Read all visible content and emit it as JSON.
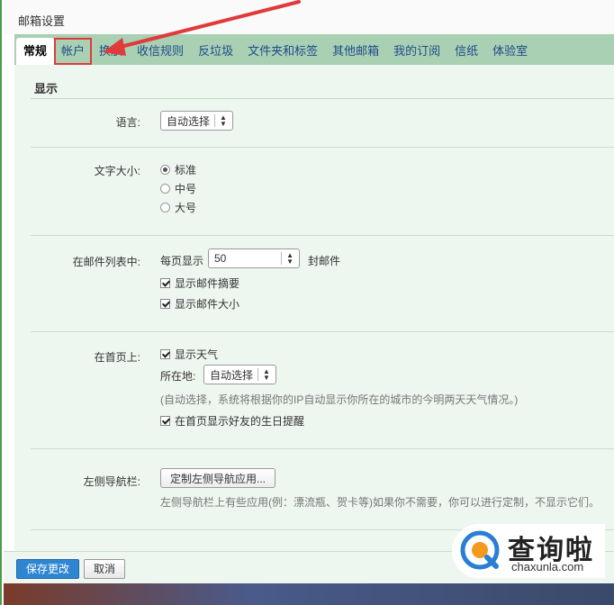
{
  "window": {
    "title": "邮箱设置"
  },
  "tabs": [
    {
      "label": "常规",
      "active": true
    },
    {
      "label": "帐户",
      "highlighted": true
    },
    {
      "label": "换肤"
    },
    {
      "label": "收信规则"
    },
    {
      "label": "反垃圾"
    },
    {
      "label": "文件夹和标签"
    },
    {
      "label": "其他邮箱"
    },
    {
      "label": "我的订阅"
    },
    {
      "label": "信纸"
    },
    {
      "label": "体验室"
    }
  ],
  "section": {
    "title": "显示"
  },
  "language": {
    "label": "语言:",
    "value": "自动选择"
  },
  "font_size": {
    "label": "文字大小:",
    "options": [
      "标准",
      "中号",
      "大号"
    ],
    "selected": "标准"
  },
  "mail_list": {
    "label": "在邮件列表中:",
    "per_page_prefix": "每页显示",
    "per_page_value": "50",
    "per_page_suffix": "封邮件",
    "show_summary": "显示邮件摘要",
    "show_size": "显示邮件大小"
  },
  "homepage": {
    "label": "在首页上:",
    "show_weather": "显示天气",
    "location_label": "所在地:",
    "location_value": "自动选择",
    "location_hint": "(自动选择，系统将根据你的IP自动显示你所在的城市的今明两天天气情况。)",
    "show_birthday": "在首页显示好友的生日提醒"
  },
  "left_nav": {
    "label": "左侧导航栏:",
    "button": "定制左侧导航应用...",
    "hint": "左侧导航栏上有些应用(例：漂流瓶、贺卡等)如果你不需要，你可以进行定制，不显示它们。"
  },
  "footer": {
    "save": "保存更改",
    "cancel": "取消"
  },
  "watermark": {
    "cn": "查询啦",
    "en": "chaxunla.com"
  },
  "colors": {
    "accent": "#2e86d1",
    "tab_bar": "#a9d0b2",
    "highlight": "#e03a3a"
  }
}
